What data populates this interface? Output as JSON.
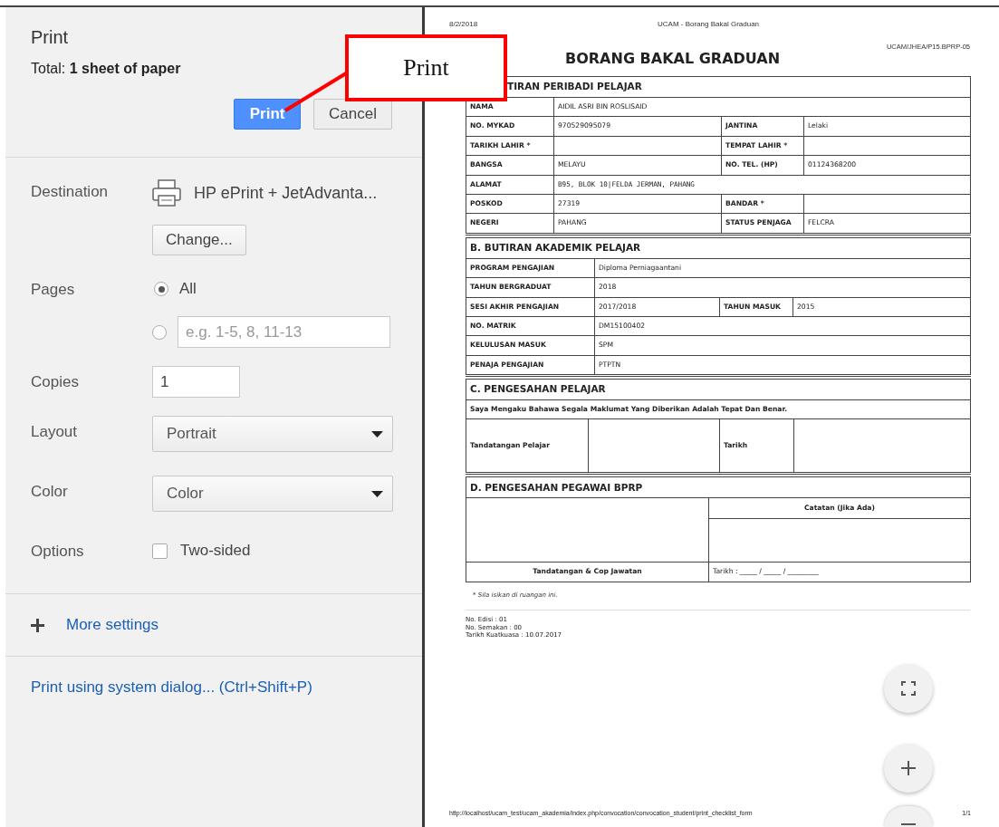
{
  "print_panel": {
    "title": "Print",
    "total": "Total: **1 sheet of paper**",
    "buttons": [
      {
        "label": "Print",
        "kind": "primary"
      },
      {
        "label": "Cancel",
        "kind": "secondary"
      }
    ],
    "settings": [
      {
        "kind": "destination",
        "label": "Destination",
        "printer": "HP ePrint + JetAdvanta...",
        "button": "Change..."
      },
      {
        "kind": "pages",
        "label": "Pages",
        "options": [
          {
            "label": "All",
            "selected": true
          },
          {
            "placeholder": "e.g. 1-5, 8, 11-13",
            "selected": false
          }
        ]
      },
      {
        "kind": "input",
        "label": "Copies",
        "value": "1"
      },
      {
        "kind": "select",
        "label": "Layout",
        "value": "Portrait"
      },
      {
        "kind": "select",
        "label": "Color",
        "value": "Color"
      },
      {
        "kind": "checkbox",
        "label": "Options",
        "option": "Two-sided",
        "checked": false
      }
    ],
    "more_settings": "More settings",
    "system_dialog": "Print using system dialog... (Ctrl+Shift+P)"
  },
  "callout": {
    "text": "Print"
  },
  "preview": {
    "header_left": "8/2/2018",
    "header_center": "UCAM - Borang Bakal Graduan",
    "code": "UCAM/JHEA/P15.BPRP-05",
    "title": "BORANG BAKAL GRADUAN",
    "sections": [
      {
        "kind": "personal",
        "heading": "TIRAN PERIBADI PELAJAR",
        "rows": [
          [
            {
              "kind": "label",
              "text": "NAMA"
            },
            {
              "kind": "value",
              "text": "AIDIL ASRI BIN ROSLISAID"
            }
          ],
          [
            {
              "kind": "label",
              "text": "NO. MYKAD"
            },
            {
              "kind": "value",
              "text": "970529095079"
            },
            {
              "kind": "label",
              "text": "JANTINA"
            },
            {
              "kind": "value",
              "text": "Lelaki"
            }
          ],
          [
            {
              "kind": "label",
              "text": "TARIKH LAHIR *"
            },
            {
              "kind": "blank"
            },
            {
              "kind": "label",
              "text": "TEMPAT LAHIR *"
            },
            {
              "kind": "blank"
            }
          ],
          [
            {
              "kind": "label",
              "text": "BANGSA"
            },
            {
              "kind": "value",
              "text": "MELAYU"
            },
            {
              "kind": "label",
              "text": "NO. TEL. (HP)"
            },
            {
              "kind": "value",
              "text": "01124368200"
            }
          ],
          [
            {
              "kind": "label",
              "text": "ALAMAT"
            },
            {
              "kind": "mono",
              "text": "B95, BLOK 10|FELDA JERMAN, PAHANG"
            }
          ],
          [
            {
              "kind": "label",
              "text": "POSKOD"
            },
            {
              "kind": "value",
              "text": "27319"
            },
            {
              "kind": "label",
              "text": "BANDAR *"
            },
            {
              "kind": "blank"
            }
          ],
          [
            {
              "kind": "label",
              "text": "NEGERI"
            },
            {
              "kind": "value",
              "text": "PAHANG"
            },
            {
              "kind": "label",
              "text": "STATUS PENJAGA"
            },
            {
              "kind": "value",
              "text": "FELCRA"
            }
          ]
        ]
      },
      {
        "kind": "academic",
        "heading": "B. BUTIRAN AKADEMIK PELAJAR",
        "rows": [
          [
            {
              "kind": "label",
              "text": "PROGRAM PENGAJIAN"
            },
            {
              "kind": "value",
              "text": "Diploma Perniagaantani"
            }
          ],
          [
            {
              "kind": "label",
              "text": "TAHUN BERGRADUAT"
            },
            {
              "kind": "value",
              "text": "2018"
            }
          ],
          [
            {
              "kind": "label",
              "text": "SESI AKHIR PENGAJIAN"
            },
            {
              "kind": "value",
              "text": "2017/2018"
            },
            {
              "kind": "label",
              "text": "TAHUN MASUK"
            },
            {
              "kind": "value",
              "text": "2015"
            }
          ],
          [
            {
              "kind": "label",
              "text": "NO. MATRIK"
            },
            {
              "kind": "value",
              "text": "DM15100402"
            }
          ],
          [
            {
              "kind": "label",
              "text": "KELULUSAN MASUK"
            },
            {
              "kind": "value",
              "text": "SPM"
            }
          ],
          [
            {
              "kind": "label",
              "text": "PENAJA PENGAJIAN"
            },
            {
              "kind": "value",
              "text": "PTPTN"
            }
          ]
        ]
      },
      {
        "kind": "student_sign",
        "heading": "C. PENGESAHAN PELAJAR",
        "rows": [
          [
            {
              "kind": "label",
              "text": "Saya Mengaku Bahawa Segala Maklumat Yang Diberikan Adalah Tepat Dan Benar."
            }
          ],
          [
            {
              "kind": "label",
              "text": "Tandatangan Pelajar"
            },
            {
              "kind": "blank"
            },
            {
              "kind": "label",
              "text": "Tarikh"
            },
            {
              "kind": "blank"
            }
          ]
        ]
      },
      {
        "kind": "officer",
        "heading": "D. PENGESAHAN PEGAWAI BPRP",
        "rows": [
          [
            {
              "kind": "blank"
            },
            {
              "kind": "center",
              "text": "Catatan (Jika Ada)"
            }
          ],
          [
            {
              "kind": "blank"
            }
          ],
          [
            {
              "kind": "center",
              "text": "Tandatangan & Cop Jawatan"
            },
            {
              "kind": "value",
              "text": "Tarikh : _____ / _____ / _________"
            }
          ]
        ]
      }
    ],
    "note": "* Sila isikan di ruangan ini.",
    "footer_lines": [
      "No. Edisi : 01",
      "No. Semakan : 00",
      "Tarikh Kuatkuasa : 10.07.2017"
    ],
    "url": "http://localhost/ucam_test/ucam_akademia/index.php/convocation/convocation_student/print_checklist_form",
    "page_number": "1/1"
  }
}
